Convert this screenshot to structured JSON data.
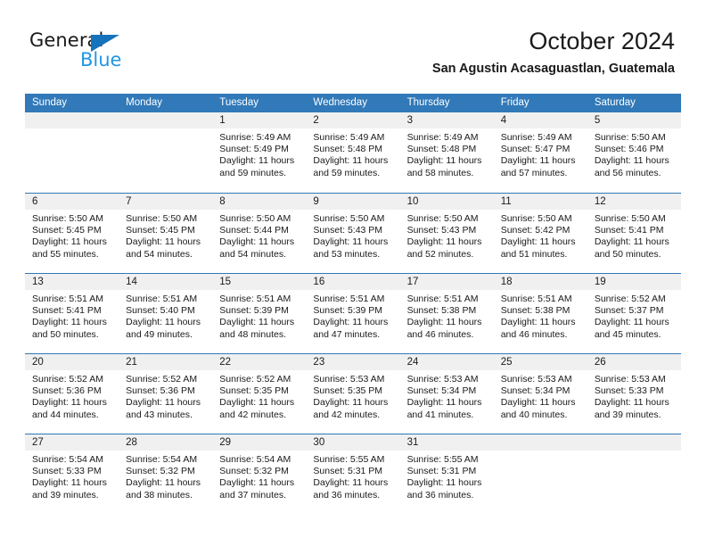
{
  "brand": {
    "name_part1": "General",
    "name_part2": "Blue",
    "triangle_color": "#1573bb",
    "blue_color": "#2196e3"
  },
  "header": {
    "title": "October 2024",
    "subtitle": "San Agustin Acasaguastlan, Guatemala"
  },
  "theme": {
    "header_bar": "#3179b8",
    "day_band": "#f0f0f0",
    "text": "#1a1a1a"
  },
  "weekdays": [
    "Sunday",
    "Monday",
    "Tuesday",
    "Wednesday",
    "Thursday",
    "Friday",
    "Saturday"
  ],
  "weeks": [
    [
      {
        "day": "",
        "empty": true,
        "sunrise": "",
        "sunset": "",
        "daylight_l1": "",
        "daylight_l2": ""
      },
      {
        "day": "",
        "empty": true,
        "sunrise": "",
        "sunset": "",
        "daylight_l1": "",
        "daylight_l2": ""
      },
      {
        "day": "1",
        "sunrise": "Sunrise: 5:49 AM",
        "sunset": "Sunset: 5:49 PM",
        "daylight_l1": "Daylight: 11 hours",
        "daylight_l2": "and 59 minutes."
      },
      {
        "day": "2",
        "sunrise": "Sunrise: 5:49 AM",
        "sunset": "Sunset: 5:48 PM",
        "daylight_l1": "Daylight: 11 hours",
        "daylight_l2": "and 59 minutes."
      },
      {
        "day": "3",
        "sunrise": "Sunrise: 5:49 AM",
        "sunset": "Sunset: 5:48 PM",
        "daylight_l1": "Daylight: 11 hours",
        "daylight_l2": "and 58 minutes."
      },
      {
        "day": "4",
        "sunrise": "Sunrise: 5:49 AM",
        "sunset": "Sunset: 5:47 PM",
        "daylight_l1": "Daylight: 11 hours",
        "daylight_l2": "and 57 minutes."
      },
      {
        "day": "5",
        "sunrise": "Sunrise: 5:50 AM",
        "sunset": "Sunset: 5:46 PM",
        "daylight_l1": "Daylight: 11 hours",
        "daylight_l2": "and 56 minutes."
      }
    ],
    [
      {
        "day": "6",
        "sunrise": "Sunrise: 5:50 AM",
        "sunset": "Sunset: 5:45 PM",
        "daylight_l1": "Daylight: 11 hours",
        "daylight_l2": "and 55 minutes."
      },
      {
        "day": "7",
        "sunrise": "Sunrise: 5:50 AM",
        "sunset": "Sunset: 5:45 PM",
        "daylight_l1": "Daylight: 11 hours",
        "daylight_l2": "and 54 minutes."
      },
      {
        "day": "8",
        "sunrise": "Sunrise: 5:50 AM",
        "sunset": "Sunset: 5:44 PM",
        "daylight_l1": "Daylight: 11 hours",
        "daylight_l2": "and 54 minutes."
      },
      {
        "day": "9",
        "sunrise": "Sunrise: 5:50 AM",
        "sunset": "Sunset: 5:43 PM",
        "daylight_l1": "Daylight: 11 hours",
        "daylight_l2": "and 53 minutes."
      },
      {
        "day": "10",
        "sunrise": "Sunrise: 5:50 AM",
        "sunset": "Sunset: 5:43 PM",
        "daylight_l1": "Daylight: 11 hours",
        "daylight_l2": "and 52 minutes."
      },
      {
        "day": "11",
        "sunrise": "Sunrise: 5:50 AM",
        "sunset": "Sunset: 5:42 PM",
        "daylight_l1": "Daylight: 11 hours",
        "daylight_l2": "and 51 minutes."
      },
      {
        "day": "12",
        "sunrise": "Sunrise: 5:50 AM",
        "sunset": "Sunset: 5:41 PM",
        "daylight_l1": "Daylight: 11 hours",
        "daylight_l2": "and 50 minutes."
      }
    ],
    [
      {
        "day": "13",
        "sunrise": "Sunrise: 5:51 AM",
        "sunset": "Sunset: 5:41 PM",
        "daylight_l1": "Daylight: 11 hours",
        "daylight_l2": "and 50 minutes."
      },
      {
        "day": "14",
        "sunrise": "Sunrise: 5:51 AM",
        "sunset": "Sunset: 5:40 PM",
        "daylight_l1": "Daylight: 11 hours",
        "daylight_l2": "and 49 minutes."
      },
      {
        "day": "15",
        "sunrise": "Sunrise: 5:51 AM",
        "sunset": "Sunset: 5:39 PM",
        "daylight_l1": "Daylight: 11 hours",
        "daylight_l2": "and 48 minutes."
      },
      {
        "day": "16",
        "sunrise": "Sunrise: 5:51 AM",
        "sunset": "Sunset: 5:39 PM",
        "daylight_l1": "Daylight: 11 hours",
        "daylight_l2": "and 47 minutes."
      },
      {
        "day": "17",
        "sunrise": "Sunrise: 5:51 AM",
        "sunset": "Sunset: 5:38 PM",
        "daylight_l1": "Daylight: 11 hours",
        "daylight_l2": "and 46 minutes."
      },
      {
        "day": "18",
        "sunrise": "Sunrise: 5:51 AM",
        "sunset": "Sunset: 5:38 PM",
        "daylight_l1": "Daylight: 11 hours",
        "daylight_l2": "and 46 minutes."
      },
      {
        "day": "19",
        "sunrise": "Sunrise: 5:52 AM",
        "sunset": "Sunset: 5:37 PM",
        "daylight_l1": "Daylight: 11 hours",
        "daylight_l2": "and 45 minutes."
      }
    ],
    [
      {
        "day": "20",
        "sunrise": "Sunrise: 5:52 AM",
        "sunset": "Sunset: 5:36 PM",
        "daylight_l1": "Daylight: 11 hours",
        "daylight_l2": "and 44 minutes."
      },
      {
        "day": "21",
        "sunrise": "Sunrise: 5:52 AM",
        "sunset": "Sunset: 5:36 PM",
        "daylight_l1": "Daylight: 11 hours",
        "daylight_l2": "and 43 minutes."
      },
      {
        "day": "22",
        "sunrise": "Sunrise: 5:52 AM",
        "sunset": "Sunset: 5:35 PM",
        "daylight_l1": "Daylight: 11 hours",
        "daylight_l2": "and 42 minutes."
      },
      {
        "day": "23",
        "sunrise": "Sunrise: 5:53 AM",
        "sunset": "Sunset: 5:35 PM",
        "daylight_l1": "Daylight: 11 hours",
        "daylight_l2": "and 42 minutes."
      },
      {
        "day": "24",
        "sunrise": "Sunrise: 5:53 AM",
        "sunset": "Sunset: 5:34 PM",
        "daylight_l1": "Daylight: 11 hours",
        "daylight_l2": "and 41 minutes."
      },
      {
        "day": "25",
        "sunrise": "Sunrise: 5:53 AM",
        "sunset": "Sunset: 5:34 PM",
        "daylight_l1": "Daylight: 11 hours",
        "daylight_l2": "and 40 minutes."
      },
      {
        "day": "26",
        "sunrise": "Sunrise: 5:53 AM",
        "sunset": "Sunset: 5:33 PM",
        "daylight_l1": "Daylight: 11 hours",
        "daylight_l2": "and 39 minutes."
      }
    ],
    [
      {
        "day": "27",
        "sunrise": "Sunrise: 5:54 AM",
        "sunset": "Sunset: 5:33 PM",
        "daylight_l1": "Daylight: 11 hours",
        "daylight_l2": "and 39 minutes."
      },
      {
        "day": "28",
        "sunrise": "Sunrise: 5:54 AM",
        "sunset": "Sunset: 5:32 PM",
        "daylight_l1": "Daylight: 11 hours",
        "daylight_l2": "and 38 minutes."
      },
      {
        "day": "29",
        "sunrise": "Sunrise: 5:54 AM",
        "sunset": "Sunset: 5:32 PM",
        "daylight_l1": "Daylight: 11 hours",
        "daylight_l2": "and 37 minutes."
      },
      {
        "day": "30",
        "sunrise": "Sunrise: 5:55 AM",
        "sunset": "Sunset: 5:31 PM",
        "daylight_l1": "Daylight: 11 hours",
        "daylight_l2": "and 36 minutes."
      },
      {
        "day": "31",
        "sunrise": "Sunrise: 5:55 AM",
        "sunset": "Sunset: 5:31 PM",
        "daylight_l1": "Daylight: 11 hours",
        "daylight_l2": "and 36 minutes."
      },
      {
        "day": "",
        "empty": true,
        "sunrise": "",
        "sunset": "",
        "daylight_l1": "",
        "daylight_l2": ""
      },
      {
        "day": "",
        "empty": true,
        "sunrise": "",
        "sunset": "",
        "daylight_l1": "",
        "daylight_l2": ""
      }
    ]
  ]
}
